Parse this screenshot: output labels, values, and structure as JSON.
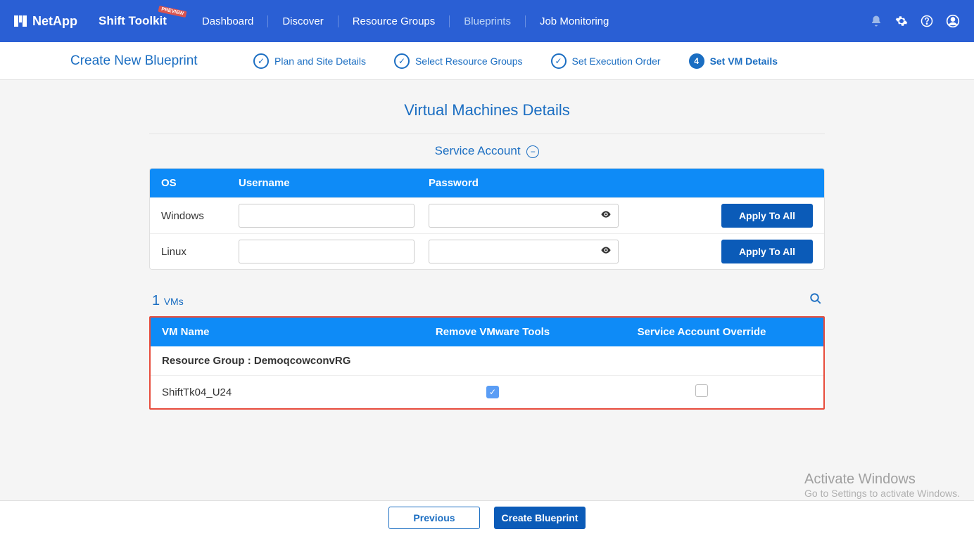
{
  "header": {
    "brand": "NetApp",
    "toolkit": "Shift Toolkit",
    "preview_badge": "PREVIEW",
    "nav": {
      "dashboard": "Dashboard",
      "discover": "Discover",
      "resource_groups": "Resource Groups",
      "blueprints": "Blueprints",
      "job_monitoring": "Job Monitoring"
    }
  },
  "subheader": {
    "title": "Create New Blueprint",
    "steps": {
      "s1": "Plan and Site Details",
      "s2": "Select Resource Groups",
      "s3": "Set Execution Order",
      "s4_num": "4",
      "s4": "Set VM Details"
    }
  },
  "page": {
    "title": "Virtual Machines Details",
    "service_account_title": "Service Account"
  },
  "service_account": {
    "headers": {
      "os": "OS",
      "username": "Username",
      "password": "Password"
    },
    "rows": {
      "windows": {
        "os": "Windows",
        "username": "",
        "password": ""
      },
      "linux": {
        "os": "Linux",
        "username": "",
        "password": ""
      }
    },
    "apply_label": "Apply To All"
  },
  "vms": {
    "count_num": "1",
    "count_label": "VMs",
    "headers": {
      "name": "VM Name",
      "remove": "Remove VMware Tools",
      "override": "Service Account Override"
    },
    "group_prefix": "Resource Group : ",
    "group_name": "DemoqcowconvRG",
    "rows": [
      {
        "name": "ShiftTk04_U24",
        "remove_checked": true,
        "override_checked": false
      }
    ]
  },
  "footer": {
    "previous": "Previous",
    "create": "Create Blueprint"
  },
  "watermark": {
    "title": "Activate Windows",
    "sub": "Go to Settings to activate Windows."
  }
}
